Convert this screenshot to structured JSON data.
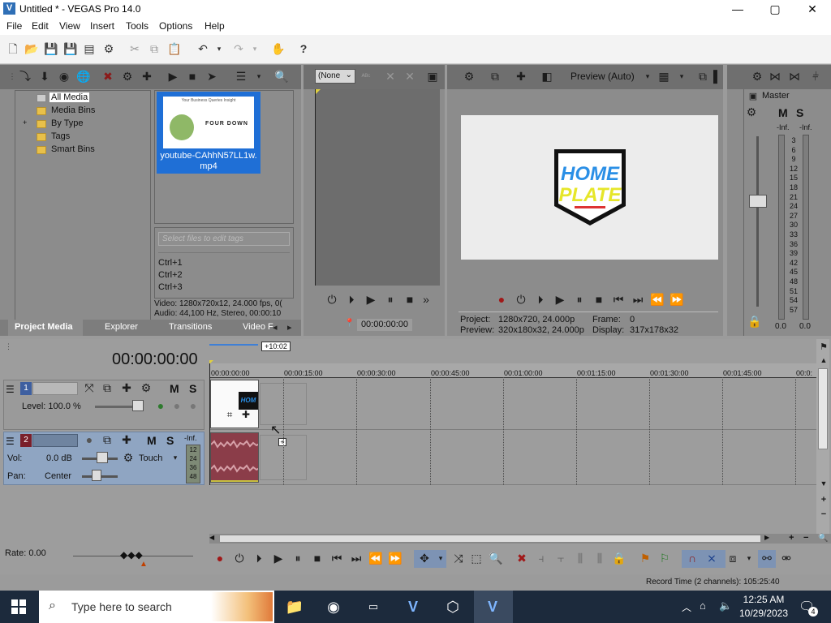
{
  "window": {
    "title": "Untitled * - VEGAS Pro 14.0",
    "logo_letter": "V",
    "minimize": "—",
    "maximize": "▢",
    "close": "✕"
  },
  "menu": [
    "File",
    "Edit",
    "View",
    "Insert",
    "Tools",
    "Options",
    "Help"
  ],
  "project_media": {
    "tree": [
      "All Media",
      "Media Bins",
      "By Type",
      "Tags",
      "Smart Bins"
    ],
    "tree_expand": "+",
    "media_file": "youtube-CAhhN57LL1w.mp4",
    "thumb_title": "Your Business Queries Insight",
    "thumb_logo": "FOUR DOWN",
    "tags_placeholder": "Select files to edit tags",
    "shortcuts": [
      "Ctrl+1",
      "Ctrl+2",
      "Ctrl+3"
    ],
    "info_video": "Video: 1280x720x12, 24.000 fps, 0(",
    "info_audio": "Audio: 44,100 Hz, Stereo, 00:00:10",
    "tabs": [
      "Project Media",
      "Explorer",
      "Transitions",
      "Video F"
    ]
  },
  "trimmer": {
    "dropdown": "(None",
    "time": "00:00:00:00"
  },
  "preview": {
    "mode": "Preview (Auto)",
    "image_text_1": "HOME",
    "image_text_2": "PLATE",
    "project_label": "Project:",
    "project_value": "1280x720, 24.000p",
    "frame_label": "Frame:",
    "frame_value": "0",
    "preview_label": "Preview:",
    "preview_value": "320x180x32, 24.000p",
    "display_label": "Display:",
    "display_value": "317x178x32"
  },
  "master": {
    "label": "Master",
    "m": "M",
    "s": "S",
    "inf_left": "-Inf.",
    "inf_right": "-Inf.",
    "scale": [
      "3",
      "6",
      "9",
      "12",
      "15",
      "18",
      "21",
      "24",
      "27",
      "30",
      "33",
      "36",
      "39",
      "42",
      "45",
      "48",
      "51",
      "54",
      "57"
    ],
    "bottom_left": "0.0",
    "bottom_right": "0.0"
  },
  "timeline": {
    "timecode": "00:00:00:00",
    "cursor_badge": "+10:02",
    "ruler": [
      "00:00:00:00",
      "00:00:15:00",
      "00:00:30:00",
      "00:00:45:00",
      "00:01:00:00",
      "00:01:15:00",
      "00:01:30:00",
      "00:01:45:00",
      "00:0:"
    ],
    "video_track": {
      "number": "1",
      "level": "Level: 100.0 %",
      "m": "M",
      "s": "S"
    },
    "audio_track": {
      "number": "2",
      "vol_label": "Vol:",
      "vol_value": "0.0 dB",
      "pan_label": "Pan:",
      "pan_value": "Center",
      "automation": "Touch",
      "m": "M",
      "s": "S",
      "inf": "-Inf.",
      "meter": [
        "12",
        "24",
        "36",
        "48"
      ]
    },
    "clip_logo": "HOM",
    "rate": "Rate: 0.00",
    "record_time": "Record Time (2 channels): 105:25:40"
  },
  "taskbar": {
    "search_placeholder": "Type here to search",
    "time": "12:25 AM",
    "date": "10/29/2023",
    "notif_count": "4"
  },
  "colors": {
    "accent_blue": "#2f6fb6",
    "selection": "#1f6fd6",
    "audio_clip": "#8b3d49",
    "taskbar": "#1c2a3c"
  }
}
